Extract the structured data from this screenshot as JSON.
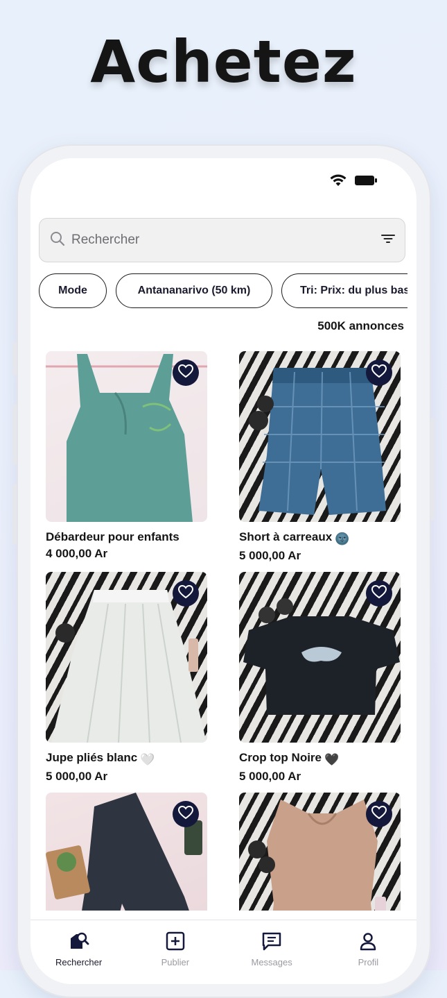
{
  "headline": "Achetez",
  "search": {
    "placeholder": "Rechercher"
  },
  "chips": [
    "Mode",
    "Antananarivo (50 km)",
    "Tri: Prix: du plus bas"
  ],
  "count_label": "500K annonces",
  "products": [
    {
      "title": "Débardeur pour enfants",
      "emoji": "",
      "price": "4 000,00 Ar",
      "image": "teal tank top"
    },
    {
      "title": "Short à carreaux",
      "emoji": "🌚",
      "price": "5 000,00 Ar",
      "image": "blue plaid shorts on zebra print"
    },
    {
      "title": "Jupe pliés blanc",
      "emoji": "🤍",
      "price": "5 000,00 Ar",
      "image": "white pleated skirt on zebra print"
    },
    {
      "title": "Crop top Noire",
      "emoji": "🖤",
      "price": "5 000,00 Ar",
      "image": "black crop top on zebra print"
    },
    {
      "title": "",
      "emoji": "",
      "price": "",
      "image": "dark jeans on pink sheet"
    },
    {
      "title": "",
      "emoji": "",
      "price": "",
      "image": "beige blouse on zebra print"
    }
  ],
  "tabs": [
    {
      "label": "Rechercher",
      "icon": "search-tag-icon",
      "active": true
    },
    {
      "label": "Publier",
      "icon": "plus-square-icon",
      "active": false
    },
    {
      "label": "Messages",
      "icon": "message-icon",
      "active": false
    },
    {
      "label": "Profil",
      "icon": "person-icon",
      "active": false
    }
  ],
  "colors": {
    "accent": "#14183a",
    "text": "#151515",
    "muted": "#9a9aa2"
  }
}
